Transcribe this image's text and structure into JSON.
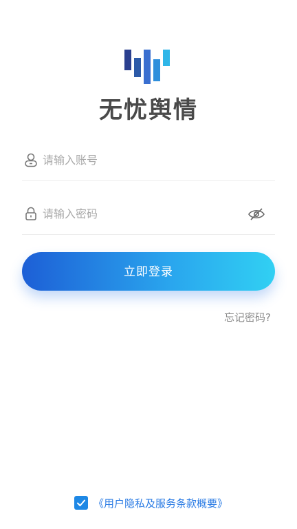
{
  "app": {
    "name": "无忧舆情",
    "logo_colors": [
      "#2a3f8f",
      "#3a6fd0",
      "#2fb6e8"
    ]
  },
  "login_form": {
    "account": {
      "icon": "user-icon",
      "placeholder": "请输入账号",
      "value": ""
    },
    "password": {
      "icon": "lock-icon",
      "placeholder": "请输入密码",
      "value": "",
      "toggle_icon": "eye-off-icon"
    },
    "submit_label": "立即登录",
    "forgot_label": "忘记密码?"
  },
  "agreement": {
    "checked": true,
    "link_label": "《用户隐私及服务条款概要》"
  },
  "colors": {
    "accent_start": "#1d5fd6",
    "accent_end": "#31d0f3",
    "link": "#2a7be4",
    "checkbox": "#1e88e5"
  }
}
